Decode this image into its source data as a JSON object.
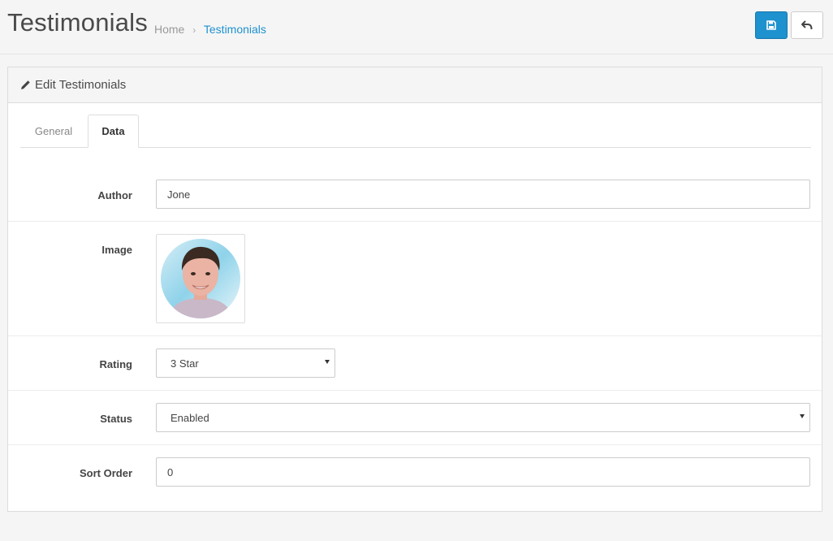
{
  "header": {
    "title": "Testimonials",
    "breadcrumb": [
      "Home",
      "Testimonials"
    ],
    "save_icon": "save-icon",
    "back_icon": "reply-icon"
  },
  "panel": {
    "heading": "Edit Testimonials",
    "heading_icon": "pencil-icon"
  },
  "tabs": [
    {
      "label": "General",
      "active": false
    },
    {
      "label": "Data",
      "active": true
    }
  ],
  "form": {
    "author": {
      "label": "Author",
      "value": "Jone"
    },
    "image": {
      "label": "Image"
    },
    "rating": {
      "label": "Rating",
      "value": "3 Star"
    },
    "status": {
      "label": "Status",
      "value": "Enabled"
    },
    "sort_order": {
      "label": "Sort Order",
      "value": "0"
    }
  },
  "colors": {
    "primary": "#1e91cf",
    "link": "#1e91cf"
  }
}
